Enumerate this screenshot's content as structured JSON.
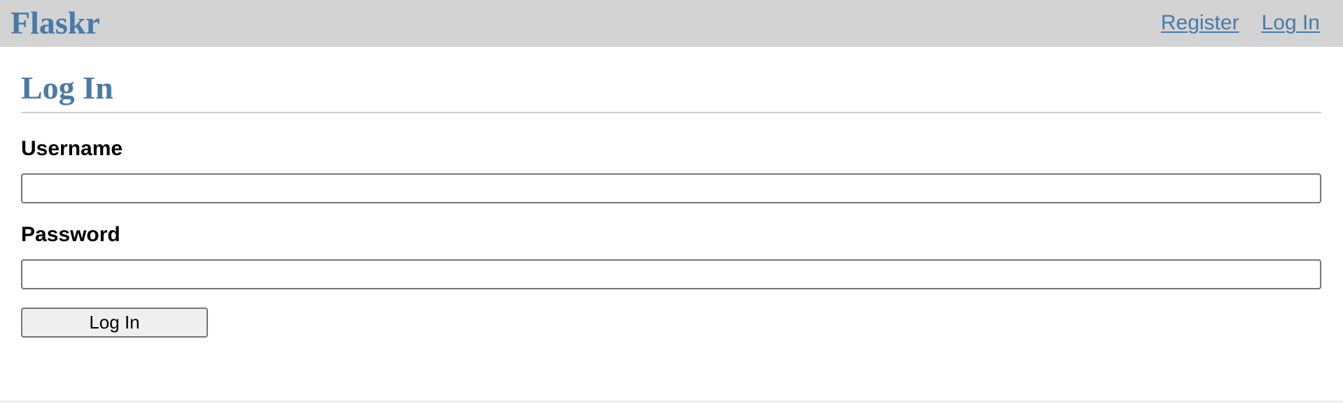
{
  "navbar": {
    "brand": "Flaskr",
    "links": [
      {
        "label": "Register"
      },
      {
        "label": "Log In"
      }
    ]
  },
  "form": {
    "title": "Log In",
    "username_label": "Username",
    "username_value": "",
    "password_label": "Password",
    "password_value": "",
    "submit_label": "Log In"
  },
  "colors": {
    "accent": "#4a7aa7",
    "navbar_bg": "#d3d3d3",
    "button_bg": "#efefef"
  }
}
